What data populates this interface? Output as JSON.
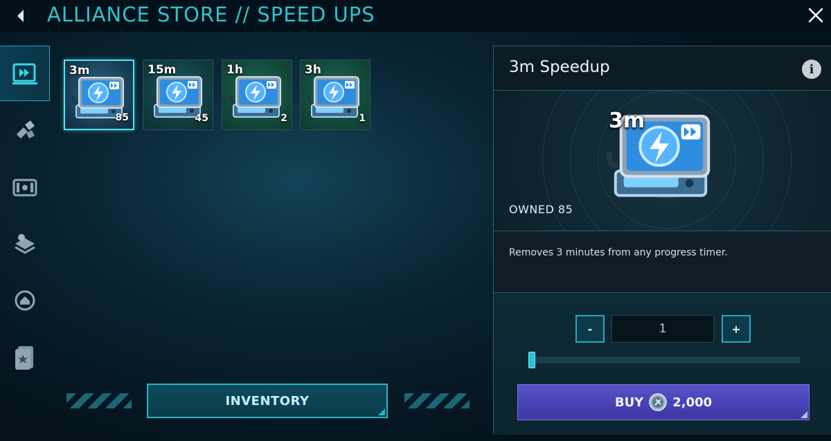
{
  "header": {
    "title": "ALLIANCE STORE // SPEED UPS",
    "back_icon": "chevron-left-icon",
    "close_icon": "close-icon"
  },
  "sidebar": {
    "items": [
      {
        "name": "speedups",
        "icon": "speedup-icon",
        "active": true
      },
      {
        "name": "resources",
        "icon": "resources-icon",
        "active": false
      },
      {
        "name": "chests",
        "icon": "chest-icon",
        "active": false
      },
      {
        "name": "buildings",
        "icon": "layers-icon",
        "active": false
      },
      {
        "name": "shield",
        "icon": "shield-home-icon",
        "active": false
      },
      {
        "name": "cards",
        "icon": "card-star-icon",
        "active": false
      }
    ]
  },
  "items": [
    {
      "label": "3m",
      "count": "85",
      "selected": true
    },
    {
      "label": "15m",
      "count": "45",
      "selected": false
    },
    {
      "label": "1h",
      "count": "2",
      "selected": false
    },
    {
      "label": "3h",
      "count": "1",
      "selected": false
    }
  ],
  "inventory": {
    "label": "INVENTORY"
  },
  "detail": {
    "title": "3m Speedup",
    "info_icon": "i",
    "preview_label": "3m",
    "owned": "OWNED 85",
    "description": "Removes 3 minutes from any progress timer.",
    "minus_label": "-",
    "plus_label": "+",
    "quantity": "1",
    "slider_fraction": 0.0,
    "buy_label": "BUY",
    "price": "2,000"
  },
  "colors": {
    "accent": "#2fc3d0",
    "buy": "#4a44b8"
  }
}
